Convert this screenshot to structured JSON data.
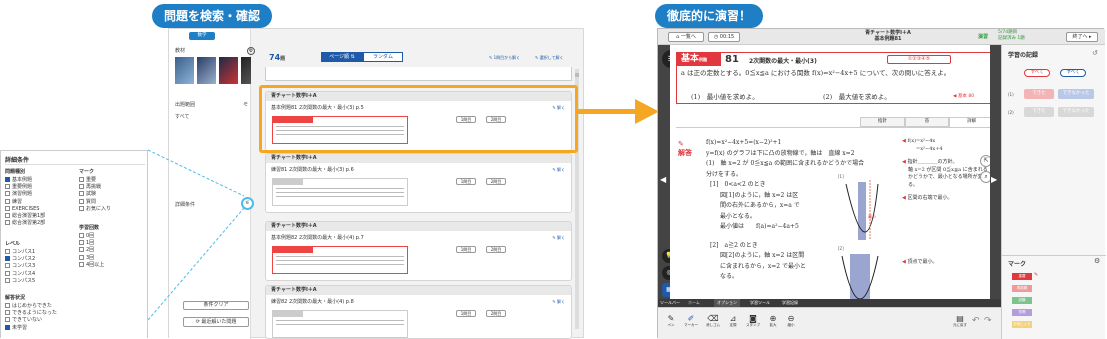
{
  "captions": {
    "left": "問題を検索・確認",
    "right": "徹底的に演習！"
  },
  "search": {
    "top_tab": "数学",
    "textbook_label": "教材",
    "range_label": "出題範囲",
    "range_value": "すべて",
    "detail_label": "詳細条件",
    "clear_button": "条件クリア",
    "recent_button": "最近解いた問題",
    "count": "74",
    "count_unit": "題",
    "page_tab": "ページ順",
    "random_tab": "ランダム",
    "link_first": "1問目から解く",
    "link_selected": "選択して解く",
    "solve_label": "解く",
    "btn_1": "1問目",
    "btn_2": "2問目",
    "cards": [
      {
        "header": "青チャート数学Ⅰ＋A",
        "title": "基本例題81 2次関数の最大・最小(3)  p.5"
      },
      {
        "header": "青チャート数学Ⅰ＋A",
        "title": "練習81 2次関数の最大・最小(3)  p.6"
      },
      {
        "header": "青チャート数学Ⅰ＋A",
        "title": "基本例題82 2次関数の最大・最小(4)  p.7"
      },
      {
        "header": "青チャート数学Ⅰ＋A",
        "title": "練習82 2次関数の最大・最小(4)  p.8"
      }
    ]
  },
  "filter": {
    "title": "詳細条件",
    "type_label": "問題種別",
    "types": [
      "基本例題",
      "重要例題",
      "演習例題",
      "練習",
      "EXERCISES",
      "総合演習第1部",
      "総合演習第2部"
    ],
    "mark_label": "マーク",
    "marks": [
      "重要",
      "再挑戦",
      "試験",
      "質問",
      "お気に入り"
    ],
    "level_label": "レベル",
    "levels": [
      "コンパス1",
      "コンパス2",
      "コンパス3",
      "コンパス4",
      "コンパス5"
    ],
    "count_label": "学習回数",
    "counts": [
      "0回",
      "1回",
      "2回",
      "3回",
      "4回以上"
    ],
    "status_label": "解答状況",
    "statuses": [
      "はじめからできた",
      "できるようになった",
      "できていない",
      "未学習"
    ]
  },
  "viewer": {
    "home": "一覧へ",
    "timer": "00:15",
    "book_title": "青チャート数学Ⅰ＋A",
    "problem_ref": "基本例題81",
    "progress": "5/74題目",
    "sub_progress": "記録済み 1題",
    "mode": "演習",
    "end_button": "終了へ",
    "problem_badge": "基本",
    "problem_badge_sub": "例題",
    "problem_number": "81",
    "problem_title": "2次関数の最大・最小(3)",
    "problem_text": "a は正の定数とする。0≦x≦a における関数 f(x)=x²−4x+5 について、次の問いに答えよ。",
    "q1": "(1)　最小値を求めよ。",
    "q2": "(2)　最大値を求めよ。",
    "ref": "基本 80",
    "tabs": [
      "指針",
      "答",
      "詳解"
    ],
    "answer_label": "解答",
    "sol_lines": [
      "f(x)=x²−4x+5=(x−2)²+1",
      "y=f(x) のグラフは下に凸の放物線で，軸は　直線 x=2",
      "(1)　軸 x=2 が 0≦x≦a の範囲に含まれるかどうかで場合",
      "分けをする。",
      "[1]　0<a<2 のとき",
      "図[1]のように，軸 x=2 は区",
      "間の右外にあるから，x=a で",
      "最小となる。",
      "最小値は　　f(a)=a²−4a+5",
      "[2]　a≧2 のとき",
      "図[2]のように，軸 x=2 は区間",
      "に含まれるから，x=2 で最小と",
      "なる。"
    ],
    "note1a": "f(x)=x²−4x",
    "note1b": "=x²−4x+4",
    "note2": "指針＿＿＿＿の方針。",
    "note3": "軸 x=2 が区間 0≦x≦a に含まれるかどうかで、最小となる場所が変わる。",
    "note4": "区間の右端で最小。",
    "note5": "頂点で最小。",
    "fig1": "[1]",
    "fig2": "[2]",
    "min_label": "最小",
    "record_title": "学習の記録",
    "rec_all": "すべて",
    "rec_all2": "すべて",
    "rec_dekita": "できた",
    "rec_dekinakatta": "できなかった",
    "rec_1": "(1)",
    "rec_2": "(2)",
    "mark_title": "マーク",
    "mark_items": [
      "重要",
      "再挑戦",
      "試験",
      "質問",
      "お気に入り"
    ],
    "toolbar": [
      "ペン",
      "マーカー",
      "消しゴム",
      "定規",
      "スタンプ",
      "拡大",
      "縮小"
    ],
    "tool_menu_label": "ツールバー",
    "tool_tabs": [
      "ホーム",
      "オプション",
      "学習ツール",
      "学習記録"
    ],
    "undo": "元に戻す"
  },
  "colors": {
    "accent": "#1e7fc6",
    "highlight": "#f5a623",
    "red": "#e0383e"
  }
}
